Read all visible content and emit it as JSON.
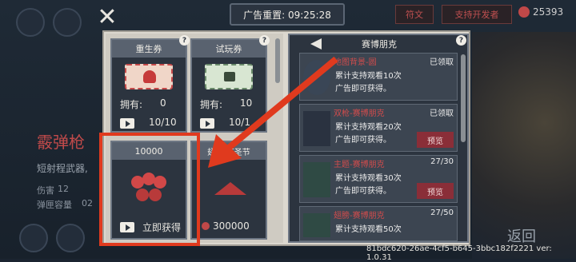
{
  "timer": {
    "label": "广告重置: 09:25:28"
  },
  "topbar": {
    "rune_label": "符文",
    "support_label": "支持开发者",
    "gold": "25393"
  },
  "weapon": {
    "name": "霰弹枪",
    "desc": "短射程武器,",
    "stat1_label": "伤害",
    "stat1_value": "12",
    "stat2_label": "弹匣容量",
    "stat2_value": "02"
  },
  "cards": [
    {
      "title": "重生券",
      "own_label": "拥有:",
      "own_value": "0",
      "count": "10/10"
    },
    {
      "title": "试玩券",
      "own_label": "拥有:",
      "own_value": "10",
      "count": "10/1"
    },
    {
      "title": "10000",
      "action": "立即获得"
    },
    {
      "title": "翅膀-万圣节",
      "price": "300000"
    }
  ],
  "list": {
    "title": "赛博朋克",
    "items": [
      {
        "name": "地图背景-圆",
        "line1": "累计支持观看10次",
        "line2": "广告即可获得。",
        "status": "已领取",
        "button": ""
      },
      {
        "name": "双枪-赛博朋克",
        "line1": "累计支持观看20次",
        "line2": "广告即可获得。",
        "status": "已领取",
        "button": "预览"
      },
      {
        "name": "主题-赛博朋克",
        "line1": "累计支持观看30次",
        "line2": "广告即可获得。",
        "status": "27/30",
        "button": "预览"
      },
      {
        "name": "翅膀-赛博朋克",
        "line1": "累计支持观看50次",
        "line2": "",
        "status": "27/50",
        "button": ""
      }
    ]
  },
  "footer": {
    "id": "81bdc620-26ae-4cf5-b645-3bbc182f2221 ver: 1.0.31",
    "back": "返回"
  },
  "colors": {
    "highlight": "#e03a1e",
    "accent_red": "#d14c4c",
    "panel": "#dcd8cf"
  },
  "icons": [
    "close-icon",
    "help-icon",
    "play-icon",
    "back-arrow-icon",
    "coin-icon",
    "heart-ticket-icon",
    "lock-ticket-icon"
  ]
}
